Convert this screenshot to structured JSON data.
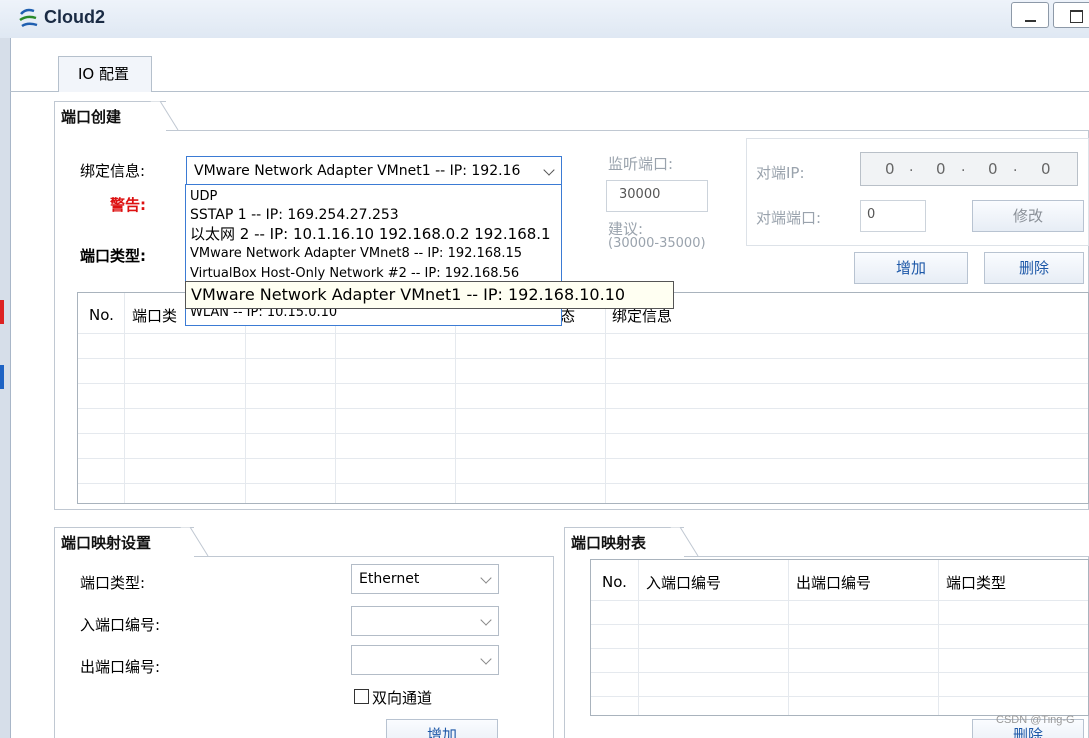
{
  "window": {
    "title": "Cloud2"
  },
  "tabs": [
    {
      "label": "IO 配置"
    }
  ],
  "port_create": {
    "section_title": "端口创建",
    "bind_label": "绑定信息:",
    "bind_value": "VMware Network Adapter VMnet1 -- IP: 192.16",
    "warning_label": "警告:",
    "port_type_label": "端口类型:",
    "listen_port_label": "监听端口:",
    "listen_port_value": "30000",
    "suggest_label": "建议:",
    "suggest_range": "(30000-35000)",
    "peer_ip_label": "对端IP:",
    "peer_ip_octets": [
      "0",
      "0",
      "0",
      "0"
    ],
    "peer_port_label": "对端端口:",
    "peer_port_value": "0",
    "modify_button": "修改",
    "add_button": "增加",
    "delete_button": "删除",
    "dropdown_options": [
      "UDP",
      "SSTAP 1 -- IP: 169.254.27.253",
      "以太网 2 -- IP: 10.1.16.10 192.168.0.2 192.168.1",
      "VMware Network Adapter VMnet8 -- IP: 192.168.15",
      "VirtualBox Host-Only Network #2 -- IP: 192.168.56",
      "WLAN -- IP: 10.15.0.10"
    ],
    "tooltip": "VMware Network Adapter VMnet1 -- IP: 192.168.10.10",
    "table_headers": [
      "No.",
      "端口类",
      "",
      "",
      "态",
      "绑定信息"
    ]
  },
  "port_mapping_settings": {
    "section_title": "端口映射设置",
    "port_type_label": "端口类型:",
    "port_type_value": "Ethernet",
    "in_port_label": "入端口编号:",
    "out_port_label": "出端口编号:",
    "bidirectional_label": "双向通道",
    "add_button": "增加"
  },
  "port_mapping_table": {
    "section_title": "端口映射表",
    "headers": [
      "No.",
      "入端口编号",
      "出端口编号",
      "端口类型"
    ],
    "delete_button": "删除"
  },
  "watermark": "CSDN @Ting-G"
}
